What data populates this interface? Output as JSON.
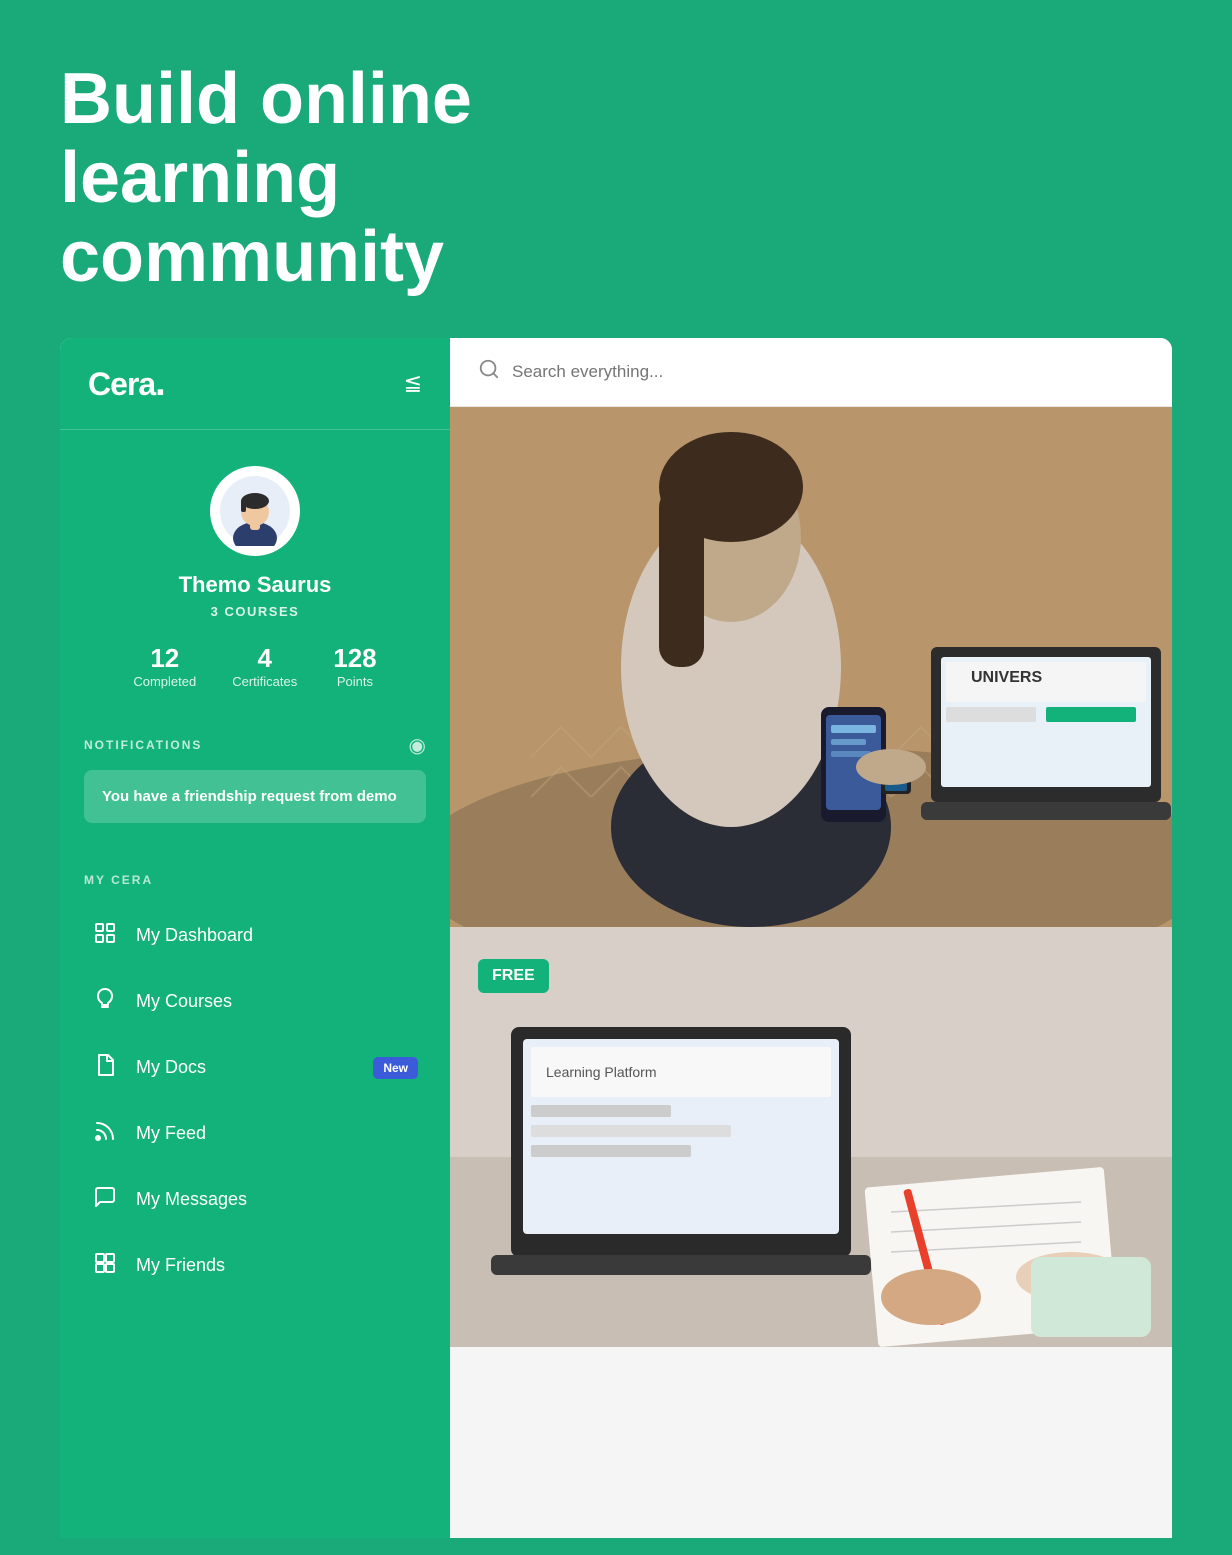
{
  "hero": {
    "title_line1": "Build online",
    "title_line2": "learning community"
  },
  "sidebar": {
    "logo": "Cera",
    "logo_dot": ".",
    "profile": {
      "name": "Themo Saurus",
      "courses_label": "3 COURSES",
      "stats": [
        {
          "number": "12",
          "label": "Completed"
        },
        {
          "number": "4",
          "label": "Certificates"
        },
        {
          "number": "128",
          "label": "Points"
        }
      ]
    },
    "notifications": {
      "title": "NOTIFICATIONS",
      "items": [
        {
          "text": "You have a friendship request from demo"
        }
      ]
    },
    "my_cera_label": "MY CERA",
    "nav_items": [
      {
        "id": "dashboard",
        "label": "My Dashboard",
        "icon": "dashboard"
      },
      {
        "id": "courses",
        "label": "My Courses",
        "icon": "courses"
      },
      {
        "id": "docs",
        "label": "My Docs",
        "icon": "docs",
        "badge": "New"
      },
      {
        "id": "feed",
        "label": "My Feed",
        "icon": "feed"
      },
      {
        "id": "messages",
        "label": "My Messages",
        "icon": "messages"
      },
      {
        "id": "friends",
        "label": "My Friends",
        "icon": "friends"
      }
    ]
  },
  "search": {
    "placeholder": "Search everything..."
  },
  "content": {
    "free_badge": "FREE"
  }
}
